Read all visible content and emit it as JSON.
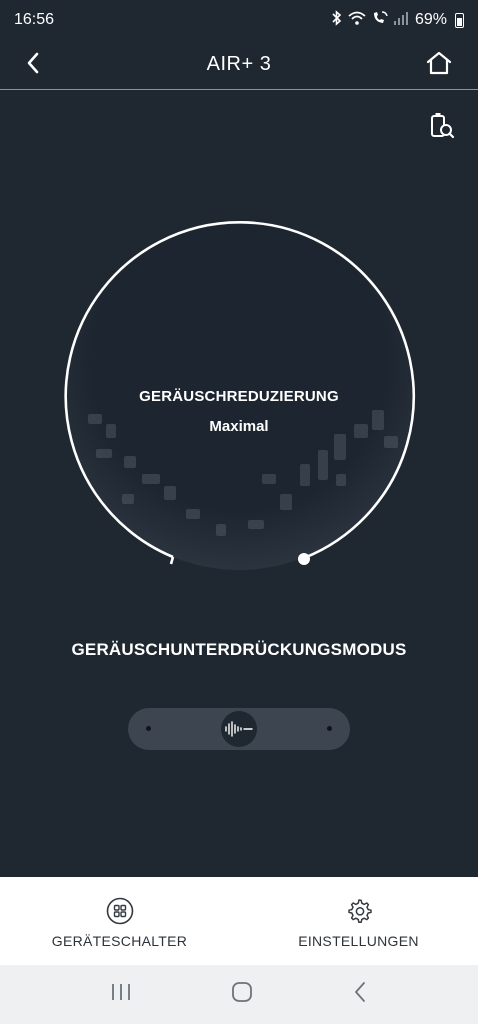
{
  "status_bar": {
    "time": "16:56",
    "battery_percent": "69%",
    "icons": [
      "bluetooth-icon",
      "wifi-icon",
      "wifi-call-icon",
      "signal-icon",
      "battery-icon"
    ]
  },
  "header": {
    "title": "AIR+ 3",
    "back_icon": "back-chevron-icon",
    "home_icon": "home-icon"
  },
  "tools": {
    "battery_search_icon": "battery-search-icon"
  },
  "noise_dial": {
    "label": "GERÄUSCHREDUZIERUNG",
    "value": "Maximal",
    "level": 1.0
  },
  "mode_section": {
    "title": "GERÄUSCHUNTERDRÜCKUNGSMODUS",
    "slider_position": "center",
    "knob_icon": "sound-wave-icon"
  },
  "bottom_nav": {
    "items": [
      {
        "label": "GERÄTESCHALTER",
        "icon": "device-grid-icon"
      },
      {
        "label": "EINSTELLUNGEN",
        "icon": "gear-icon"
      }
    ]
  },
  "system_nav": {
    "items": [
      "recent-apps-icon",
      "home-circle-icon",
      "back-icon"
    ]
  },
  "colors": {
    "background": "#1f2730",
    "arc": "#ffffff",
    "slider_track": "#3d4650",
    "nav_background": "#ffffff"
  }
}
